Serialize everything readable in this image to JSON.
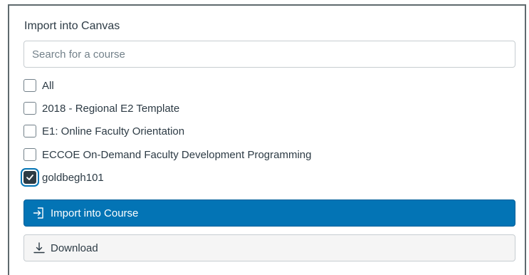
{
  "panel": {
    "title": "Import into Canvas"
  },
  "search": {
    "placeholder": "Search for a course",
    "value": ""
  },
  "courses": [
    {
      "label": "All",
      "checked": false
    },
    {
      "label": "2018 - Regional E2 Template",
      "checked": false
    },
    {
      "label": "E1: Online Faculty Orientation",
      "checked": false
    },
    {
      "label": "ECCOE On-Demand Faculty Development Programming",
      "checked": false
    },
    {
      "label": "goldbegh101",
      "checked": true
    }
  ],
  "actions": {
    "import_label": "Import into Course",
    "import_icon": "import-icon",
    "download_label": "Download",
    "download_icon": "download-icon"
  },
  "colors": {
    "primary": "#0374b5",
    "text": "#2d3b45",
    "border": "#c7cdd1"
  }
}
